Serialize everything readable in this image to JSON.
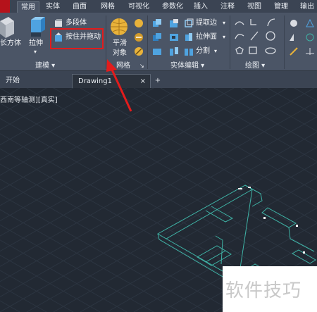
{
  "ribbon_tabs": [
    "常用",
    "实体",
    "曲面",
    "网格",
    "可视化",
    "参数化",
    "插入",
    "注释",
    "视图",
    "管理",
    "输出"
  ],
  "ribbon": {
    "box_label": "长方体",
    "extrude_label": "拉伸",
    "polysolid_label": "多段体",
    "presspull_label": "按住并拖动",
    "smooth_label_1": "平滑",
    "smooth_label_2": "对象",
    "extract_edges_label": "提取边",
    "extrude_faces_label": "拉伸面",
    "separate_label": "分割",
    "panel_modeling": "建模",
    "panel_mesh": "网格",
    "panel_solid_editing": "实体编辑",
    "panel_draw": "绘图"
  },
  "doc_tabs": {
    "start": "开始",
    "drawing": "Drawing1",
    "close_glyph": "×",
    "add_glyph": "+"
  },
  "viewport_label": "西南等轴测][真实]",
  "watermark": "软件技巧",
  "colors": {
    "ribbon_bg": "#4b5566",
    "tab_bar_bg": "#3b4453",
    "viewport_bg": "#222933",
    "highlight": "#e21c1c",
    "model_lines": "#3fb3a6"
  }
}
